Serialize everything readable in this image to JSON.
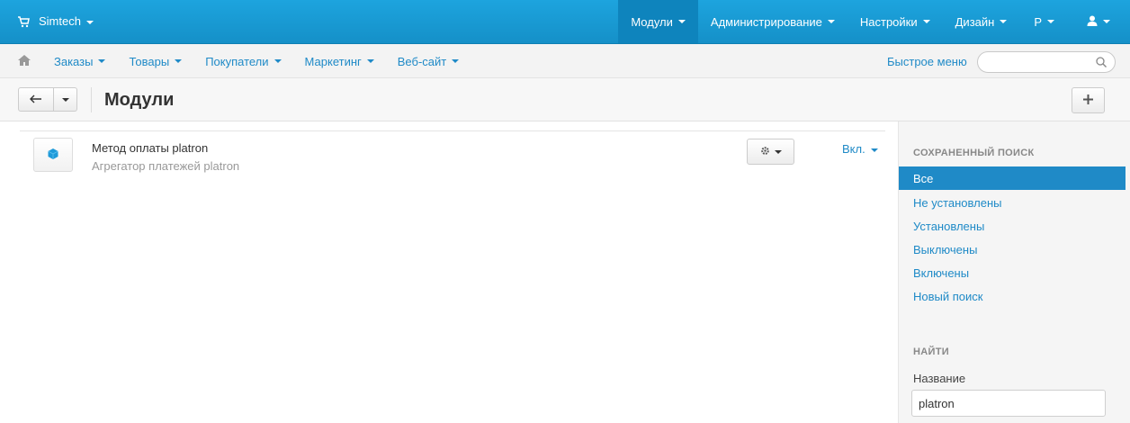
{
  "topbar": {
    "brand": "Simtech",
    "nav": [
      {
        "label": "Модули",
        "active": true
      },
      {
        "label": "Администрирование",
        "active": false
      },
      {
        "label": "Настройки",
        "active": false
      },
      {
        "label": "Дизайн",
        "active": false
      },
      {
        "label": "Р",
        "active": false
      }
    ]
  },
  "subbar": {
    "menu": [
      "Заказы",
      "Товары",
      "Покупатели",
      "Маркетинг",
      "Веб-сайт"
    ],
    "quick_menu": "Быстрое меню",
    "search_value": ""
  },
  "page": {
    "title": "Модули"
  },
  "addon": {
    "name": "Метод оплаты platron",
    "description": "Агрегатор платежей platron",
    "status": "Вкл."
  },
  "sidebar": {
    "saved_search_heading": "СОХРАНЕННЫЙ ПОИСК",
    "items": [
      "Все",
      "Не установлены",
      "Установлены",
      "Выключены",
      "Включены",
      "Новый поиск"
    ],
    "active_index": 0,
    "find_heading": "НАЙТИ",
    "name_label": "Название",
    "name_value": "platron"
  },
  "colors": {
    "topbar": "#189bd4",
    "link": "#1f8ac7",
    "active_sidebar": "#1f8ac7"
  }
}
